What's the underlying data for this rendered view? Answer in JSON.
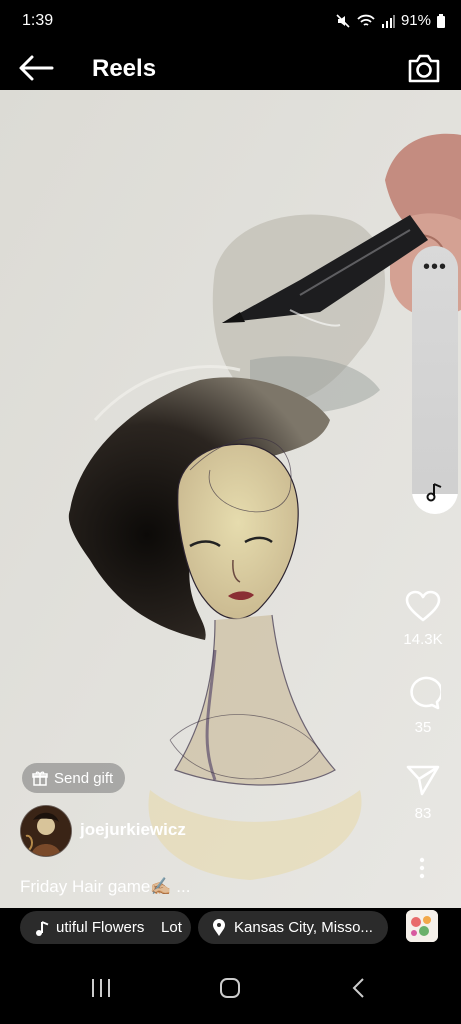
{
  "status_bar": {
    "time": "1:39",
    "battery": "91%"
  },
  "header": {
    "title": "Reels"
  },
  "side_pill": {
    "menu_icon": "more-horizontal-icon",
    "music_icon": "music-note-icon"
  },
  "actions": {
    "likes": "14.3K",
    "comments": "35",
    "shares": "83"
  },
  "gift": {
    "label": "Send gift"
  },
  "author": {
    "username": "joejurkiewicz"
  },
  "caption": {
    "text": "Friday Hair game✍🏼 ..."
  },
  "chips": {
    "music": "utiful Flowers    Lot",
    "location": "Kansas City, Misso..."
  },
  "colors": {
    "background": "#000000",
    "chip": "#2b2b2b",
    "paper": "#e3e2dd"
  }
}
